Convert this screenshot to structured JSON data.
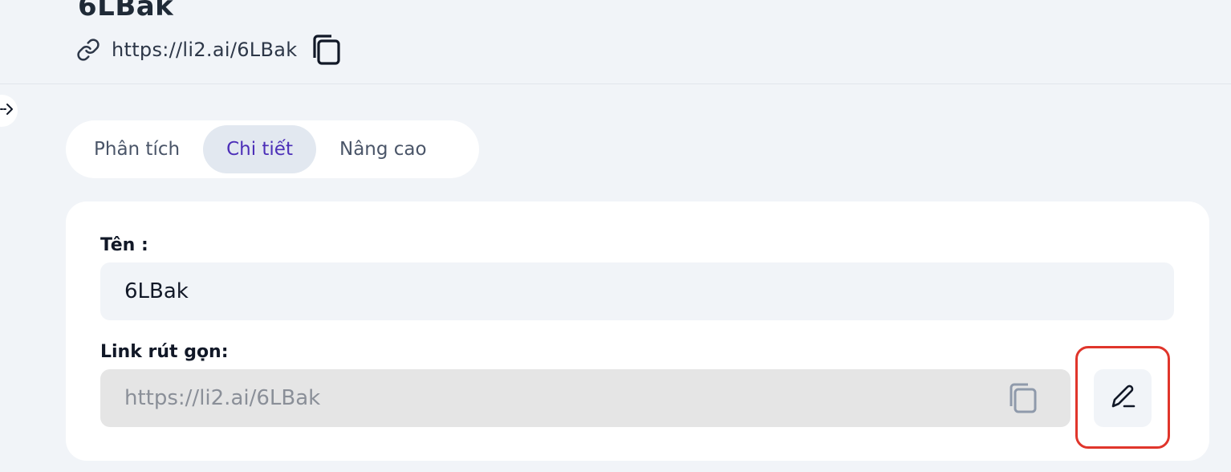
{
  "header": {
    "title": "6LBak",
    "short_url": "https://li2.ai/6LBak",
    "link_icon": "link-icon",
    "copy_icon": "copy-icon"
  },
  "sidebar_toggle": {
    "icon": "arrow-right-icon"
  },
  "tabs": [
    {
      "label": "Phân tích",
      "active": false
    },
    {
      "label": "Chi tiết",
      "active": true
    },
    {
      "label": "Nâng cao",
      "active": false
    }
  ],
  "details": {
    "name_label": "Tên :",
    "name_value": "6LBak",
    "short_link_label": "Link rút gọn:",
    "short_link_value": "https://li2.ai/6LBak",
    "copy_icon": "copy-icon",
    "edit_icon": "pencil-icon"
  },
  "colors": {
    "accent": "#4c2fb8",
    "highlight": "#e0352b",
    "background": "#f1f4f8"
  }
}
